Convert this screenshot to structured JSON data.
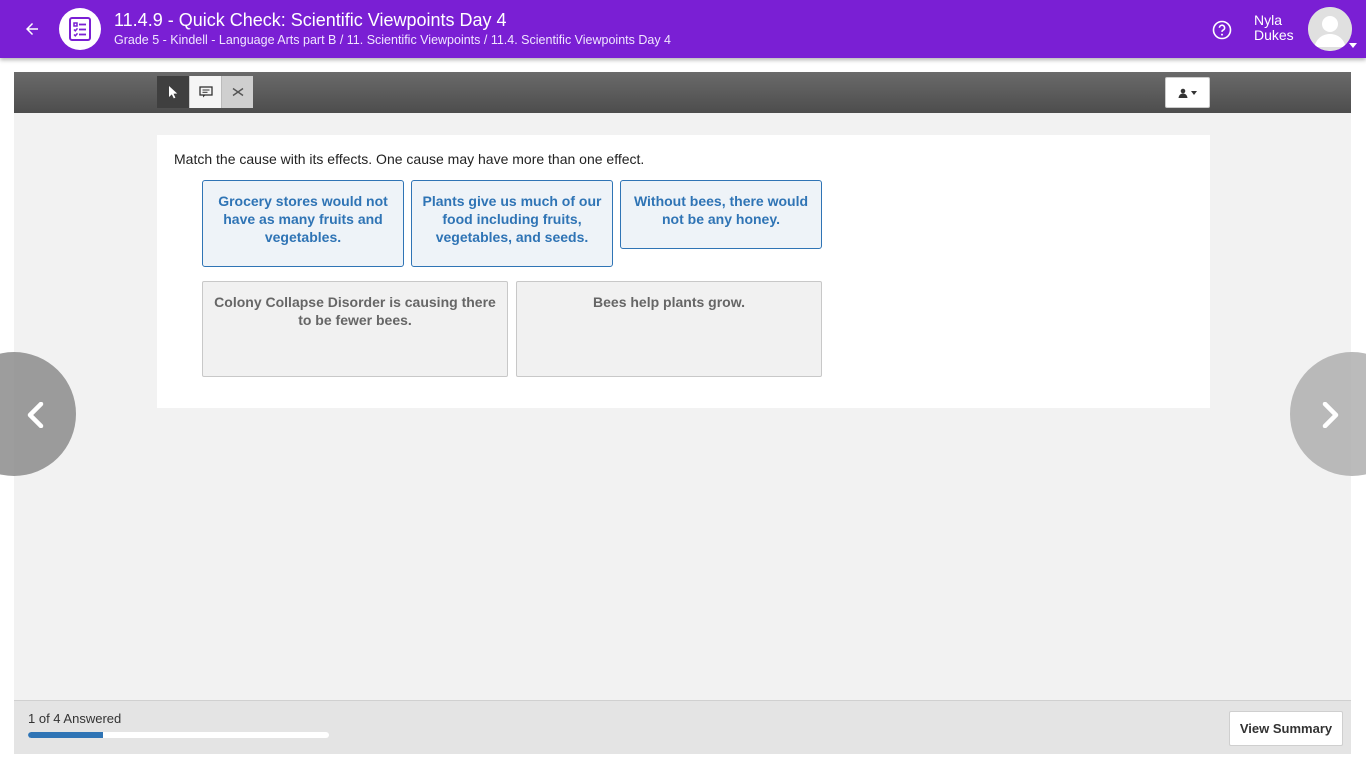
{
  "header": {
    "title": "11.4.9 - Quick Check: Scientific Viewpoints Day 4",
    "breadcrumb": "Grade 5 - Kindell - Language Arts part B / 11. Scientific Viewpoints / 11.4. Scientific Viewpoints Day 4",
    "back_icon": "arrow-left-icon",
    "app_icon": "checklist-icon",
    "help_icon": "help-circle-icon",
    "user": {
      "first_name": "Nyla",
      "last_name": "Dukes"
    }
  },
  "toolbar": {
    "tools": [
      {
        "name": "pointer",
        "icon": "pointer-icon",
        "active": true
      },
      {
        "name": "note",
        "icon": "note-icon",
        "active": false
      },
      {
        "name": "eliminate",
        "icon": "cross-icon",
        "active": false
      }
    ],
    "user_menu_icon": "user-icon"
  },
  "question": {
    "prompt": "Match the cause with its effects. One cause may have more than one effect.",
    "effects": [
      "Grocery stores would not have as many fruits and vegetables.",
      "Plants give us much of our food including fruits, vegetables, and seeds.",
      "Without bees, there would not be any honey."
    ],
    "causes": [
      "Colony Collapse Disorder is causing there to be fewer bees.",
      "Bees help plants grow."
    ]
  },
  "footer": {
    "answered_text": "1 of 4 Answered",
    "progress_fraction": 0.25,
    "view_summary_label": "View Summary"
  },
  "colors": {
    "header_bg": "#7a1fd4",
    "accent": "#2f74b5"
  }
}
